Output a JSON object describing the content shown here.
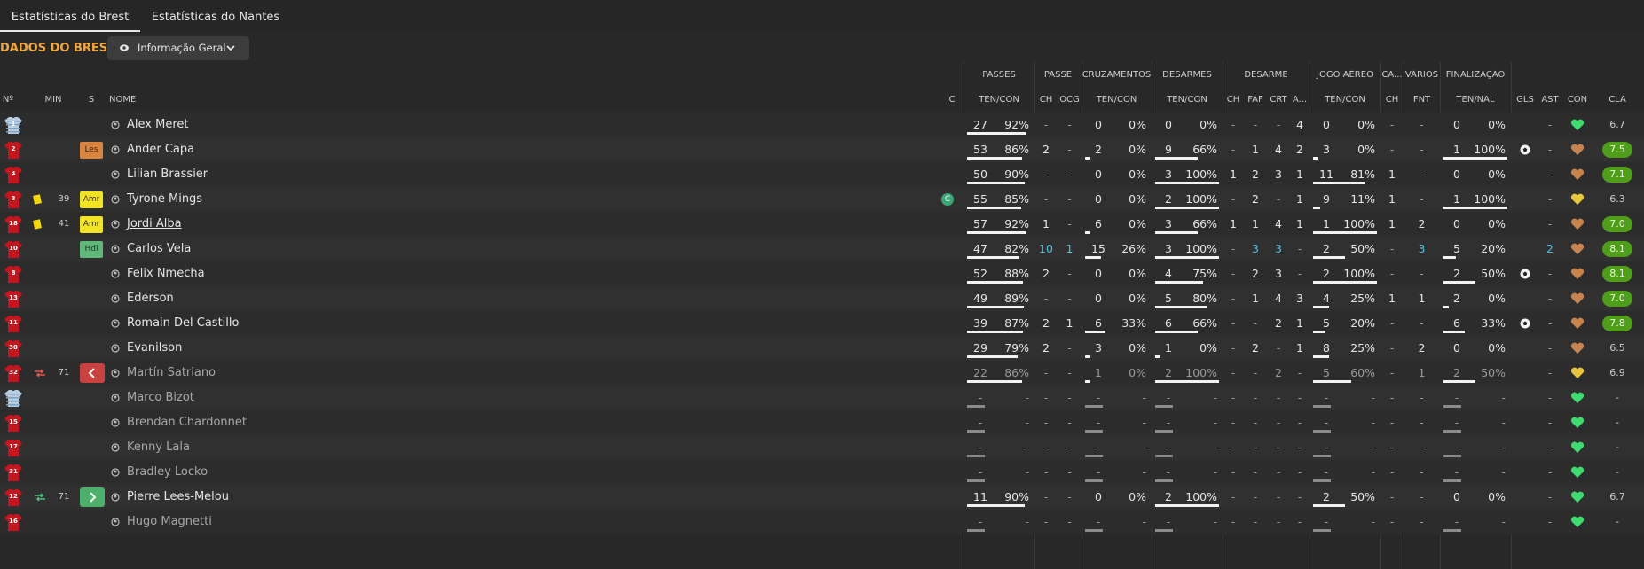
{
  "tabs": [
    {
      "label": "Estatísticas do Brest",
      "active": true
    },
    {
      "label": "Estatísticas do Nantes",
      "active": false
    }
  ],
  "section_title": "DADOS DO BREST",
  "view_dropdown": {
    "label": "Informação Geral"
  },
  "group_headers": {
    "passes": "PASSES",
    "passe": "PASSE",
    "cruzamentos": "CRUZAMENTOS",
    "desarmes": "DESARMES",
    "desarme": "DESARME",
    "jogo_aereo": "JOGO AÉREO",
    "ca": "CA...",
    "varios": "VÁRIOS",
    "finalizacao": "FINALIZAÇÃO"
  },
  "column_headers": {
    "n": "Nº",
    "min": "MIN",
    "s": "S",
    "nome": "NOME",
    "c": "C",
    "passes_tc": "TEN/CON",
    "passe_ch": "CH",
    "passe_ocg": "OCG",
    "cruz_tc": "TEN/CON",
    "desarmes_tc": "TEN/CON",
    "des_ch": "CH",
    "des_faf": "FAF",
    "des_crt": "CRT",
    "des_a": "A...",
    "aereo_tc": "TEN/CON",
    "ca_ch": "CH",
    "fnt": "FNT",
    "fin_tn": "TEN/NAL",
    "gls": "GLS",
    "ast": "AST",
    "con": "CON",
    "cla": "CLA"
  },
  "colors": {
    "accent": "#f2a93b",
    "cyan": "#4fc3e6",
    "rating_green": "#4f9e1a",
    "heart_green": "#3ddc6e"
  },
  "players": [
    {
      "num": "1",
      "min": "",
      "pos": "",
      "name": "Alex Meret",
      "passes_t": "27",
      "passes_c": "92%",
      "passe_ch": "-",
      "passe_ocg": "-",
      "cruz_t": "0",
      "cruz_c": "0%",
      "des_t": "0",
      "des_c": "0%",
      "ch": "-",
      "faf": "-",
      "crt": "-",
      "a": "4",
      "aer_t": "0",
      "aer_c": "0%",
      "ca": "-",
      "fnt": "-",
      "fin_t": "0",
      "fin_c": "0%",
      "gls": "",
      "ast": "-",
      "heart": "green",
      "cla": "6.7"
    },
    {
      "num": "2",
      "min": "",
      "pos": "Les",
      "name": "Ander Capa",
      "passes_t": "53",
      "passes_c": "86%",
      "passe_ch": "2",
      "passe_ocg": "-",
      "cruz_t": "2",
      "cruz_c": "0%",
      "des_t": "9",
      "des_c": "66%",
      "ch": "-",
      "faf": "1",
      "crt": "4",
      "a": "2",
      "aer_t": "3",
      "aer_c": "0%",
      "ca": "-",
      "fnt": "-",
      "fin_t": "1",
      "fin_c": "100%",
      "gls": "ball",
      "ast": "-",
      "heart": "brown",
      "cla": "7.5"
    },
    {
      "num": "4",
      "min": "",
      "pos": "",
      "name": "Lilian Brassier",
      "passes_t": "50",
      "passes_c": "90%",
      "passe_ch": "-",
      "passe_ocg": "-",
      "cruz_t": "0",
      "cruz_c": "0%",
      "des_t": "3",
      "des_c": "100%",
      "ch": "1",
      "faf": "2",
      "crt": "3",
      "a": "1",
      "aer_t": "11",
      "aer_c": "81%",
      "ca": "1",
      "fnt": "-",
      "fin_t": "0",
      "fin_c": "0%",
      "gls": "",
      "ast": "-",
      "heart": "brown",
      "cla": "7.1"
    },
    {
      "num": "3",
      "min": "39",
      "pos": "Amr",
      "name": "Tyrone Mings",
      "passes_t": "55",
      "passes_c": "85%",
      "passe_ch": "-",
      "passe_ocg": "-",
      "cruz_t": "0",
      "cruz_c": "0%",
      "des_t": "2",
      "des_c": "100%",
      "ch": "-",
      "faf": "2",
      "crt": "-",
      "a": "1",
      "aer_t": "9",
      "aer_c": "11%",
      "ca": "1",
      "fnt": "-",
      "fin_t": "1",
      "fin_c": "100%",
      "gls": "",
      "ast": "-",
      "heart": "yellow",
      "cla": "6.3",
      "c_icon": "C"
    },
    {
      "num": "18",
      "min": "41",
      "pos": "Amr",
      "name": "Jordi Alba",
      "passes_t": "57",
      "passes_c": "92%",
      "passe_ch": "1",
      "passe_ocg": "-",
      "cruz_t": "6",
      "cruz_c": "0%",
      "des_t": "3",
      "des_c": "66%",
      "ch": "1",
      "faf": "1",
      "crt": "4",
      "a": "1",
      "aer_t": "1",
      "aer_c": "100%",
      "ca": "1",
      "fnt": "2",
      "fin_t": "0",
      "fin_c": "0%",
      "gls": "",
      "ast": "-",
      "heart": "brown",
      "cla": "7.0"
    },
    {
      "num": "10",
      "min": "",
      "pos": "Hdl",
      "name": "Carlos Vela",
      "passes_t": "47",
      "passes_c": "82%",
      "passe_ch": "10",
      "passe_ocg": "1",
      "cruz_t": "15",
      "cruz_c": "26%",
      "des_t": "3",
      "des_c": "100%",
      "ch": "-",
      "faf": "3",
      "crt": "3",
      "a": "-",
      "aer_t": "2",
      "aer_c": "50%",
      "ca": "-",
      "fnt": "3",
      "fin_t": "5",
      "fin_c": "20%",
      "gls": "",
      "ast": "2",
      "heart": "brown",
      "cla": "8.1"
    },
    {
      "num": "8",
      "min": "",
      "pos": "",
      "name": "Felix Nmecha",
      "passes_t": "52",
      "passes_c": "88%",
      "passe_ch": "2",
      "passe_ocg": "-",
      "cruz_t": "0",
      "cruz_c": "0%",
      "des_t": "4",
      "des_c": "75%",
      "ch": "-",
      "faf": "2",
      "crt": "3",
      "a": "-",
      "aer_t": "2",
      "aer_c": "100%",
      "ca": "-",
      "fnt": "-",
      "fin_t": "2",
      "fin_c": "50%",
      "gls": "ball",
      "ast": "-",
      "heart": "brown",
      "cla": "8.1"
    },
    {
      "num": "13",
      "min": "",
      "pos": "",
      "name": "Ederson",
      "passes_t": "49",
      "passes_c": "89%",
      "passe_ch": "-",
      "passe_ocg": "-",
      "cruz_t": "0",
      "cruz_c": "0%",
      "des_t": "5",
      "des_c": "80%",
      "ch": "-",
      "faf": "1",
      "crt": "4",
      "a": "3",
      "aer_t": "4",
      "aer_c": "25%",
      "ca": "1",
      "fnt": "1",
      "fin_t": "2",
      "fin_c": "0%",
      "gls": "",
      "ast": "-",
      "heart": "brown",
      "cla": "7.0"
    },
    {
      "num": "11",
      "min": "",
      "pos": "",
      "name": "Romain Del Castillo",
      "passes_t": "39",
      "passes_c": "87%",
      "passe_ch": "2",
      "passe_ocg": "1",
      "cruz_t": "6",
      "cruz_c": "33%",
      "des_t": "6",
      "des_c": "66%",
      "ch": "-",
      "faf": "-",
      "crt": "2",
      "a": "1",
      "aer_t": "5",
      "aer_c": "20%",
      "ca": "-",
      "fnt": "-",
      "fin_t": "6",
      "fin_c": "33%",
      "gls": "ball",
      "ast": "-",
      "heart": "brown",
      "cla": "7.8"
    },
    {
      "num": "30",
      "min": "",
      "pos": "",
      "name": "Evanilson",
      "passes_t": "29",
      "passes_c": "79%",
      "passe_ch": "2",
      "passe_ocg": "-",
      "cruz_t": "3",
      "cruz_c": "0%",
      "des_t": "1",
      "des_c": "0%",
      "ch": "-",
      "faf": "2",
      "crt": "-",
      "a": "1",
      "aer_t": "8",
      "aer_c": "25%",
      "ca": "-",
      "fnt": "2",
      "fin_t": "0",
      "fin_c": "0%",
      "gls": "",
      "ast": "-",
      "heart": "brown",
      "cla": "6.5"
    },
    {
      "num": "32",
      "min": "71",
      "pos": "",
      "name": "Martín Satriano",
      "passes_t": "22",
      "passes_c": "86%",
      "passe_ch": "-",
      "passe_ocg": "-",
      "cruz_t": "1",
      "cruz_c": "0%",
      "des_t": "2",
      "des_c": "100%",
      "ch": "-",
      "faf": "-",
      "crt": "2",
      "a": "-",
      "aer_t": "5",
      "aer_c": "60%",
      "ca": "-",
      "fnt": "1",
      "fin_t": "2",
      "fin_c": "50%",
      "gls": "",
      "ast": "-",
      "heart": "yellow",
      "cla": "6.9"
    },
    {
      "num": "",
      "min": "",
      "pos": "",
      "name": "Marco Bizot",
      "passes_t": "-",
      "passes_c": "-",
      "passe_ch": "-",
      "passe_ocg": "-",
      "cruz_t": "-",
      "cruz_c": "-",
      "des_t": "-",
      "des_c": "-",
      "ch": "-",
      "faf": "-",
      "crt": "-",
      "a": "-",
      "aer_t": "-",
      "aer_c": "-",
      "ca": "-",
      "fnt": "-",
      "fin_t": "-",
      "fin_c": "-",
      "gls": "",
      "ast": "-",
      "heart": "green",
      "cla": "-"
    },
    {
      "num": "15",
      "min": "",
      "pos": "",
      "name": "Brendan Chardonnet",
      "passes_t": "-",
      "passes_c": "-",
      "passe_ch": "-",
      "passe_ocg": "-",
      "cruz_t": "-",
      "cruz_c": "-",
      "des_t": "-",
      "des_c": "-",
      "ch": "-",
      "faf": "-",
      "crt": "-",
      "a": "-",
      "aer_t": "-",
      "aer_c": "-",
      "ca": "-",
      "fnt": "-",
      "fin_t": "-",
      "fin_c": "-",
      "gls": "",
      "ast": "-",
      "heart": "green",
      "cla": "-"
    },
    {
      "num": "17",
      "min": "",
      "pos": "",
      "name": "Kenny Lala",
      "passes_t": "-",
      "passes_c": "-",
      "passe_ch": "-",
      "passe_ocg": "-",
      "cruz_t": "-",
      "cruz_c": "-",
      "des_t": "-",
      "des_c": "-",
      "ch": "-",
      "faf": "-",
      "crt": "-",
      "a": "-",
      "aer_t": "-",
      "aer_c": "-",
      "ca": "-",
      "fnt": "-",
      "fin_t": "-",
      "fin_c": "-",
      "gls": "",
      "ast": "-",
      "heart": "green",
      "cla": "-"
    },
    {
      "num": "31",
      "min": "",
      "pos": "",
      "name": "Bradley Locko",
      "passes_t": "-",
      "passes_c": "-",
      "passe_ch": "-",
      "passe_ocg": "-",
      "cruz_t": "-",
      "cruz_c": "-",
      "des_t": "-",
      "des_c": "-",
      "ch": "-",
      "faf": "-",
      "crt": "-",
      "a": "-",
      "aer_t": "-",
      "aer_c": "-",
      "ca": "-",
      "fnt": "-",
      "fin_t": "-",
      "fin_c": "-",
      "gls": "",
      "ast": "-",
      "heart": "green",
      "cla": "-"
    },
    {
      "num": "12",
      "min": "71",
      "pos": "",
      "name": "Pierre Lees-Melou",
      "passes_t": "11",
      "passes_c": "90%",
      "passe_ch": "-",
      "passe_ocg": "-",
      "cruz_t": "0",
      "cruz_c": "0%",
      "des_t": "2",
      "des_c": "100%",
      "ch": "-",
      "faf": "-",
      "crt": "-",
      "a": "-",
      "aer_t": "2",
      "aer_c": "50%",
      "ca": "-",
      "fnt": "-",
      "fin_t": "0",
      "fin_c": "0%",
      "gls": "",
      "ast": "-",
      "heart": "green",
      "cla": "6.7"
    },
    {
      "num": "16",
      "min": "",
      "pos": "",
      "name": "Hugo Magnetti",
      "passes_t": "-",
      "passes_c": "-",
      "passe_ch": "-",
      "passe_ocg": "-",
      "cruz_t": "-",
      "cruz_c": "-",
      "des_t": "-",
      "des_c": "-",
      "ch": "-",
      "faf": "-",
      "crt": "-",
      "a": "-",
      "aer_t": "-",
      "aer_c": "-",
      "ca": "-",
      "fnt": "-",
      "fin_t": "-",
      "fin_c": "-",
      "gls": "",
      "ast": "-",
      "heart": "green",
      "cla": "-"
    }
  ]
}
